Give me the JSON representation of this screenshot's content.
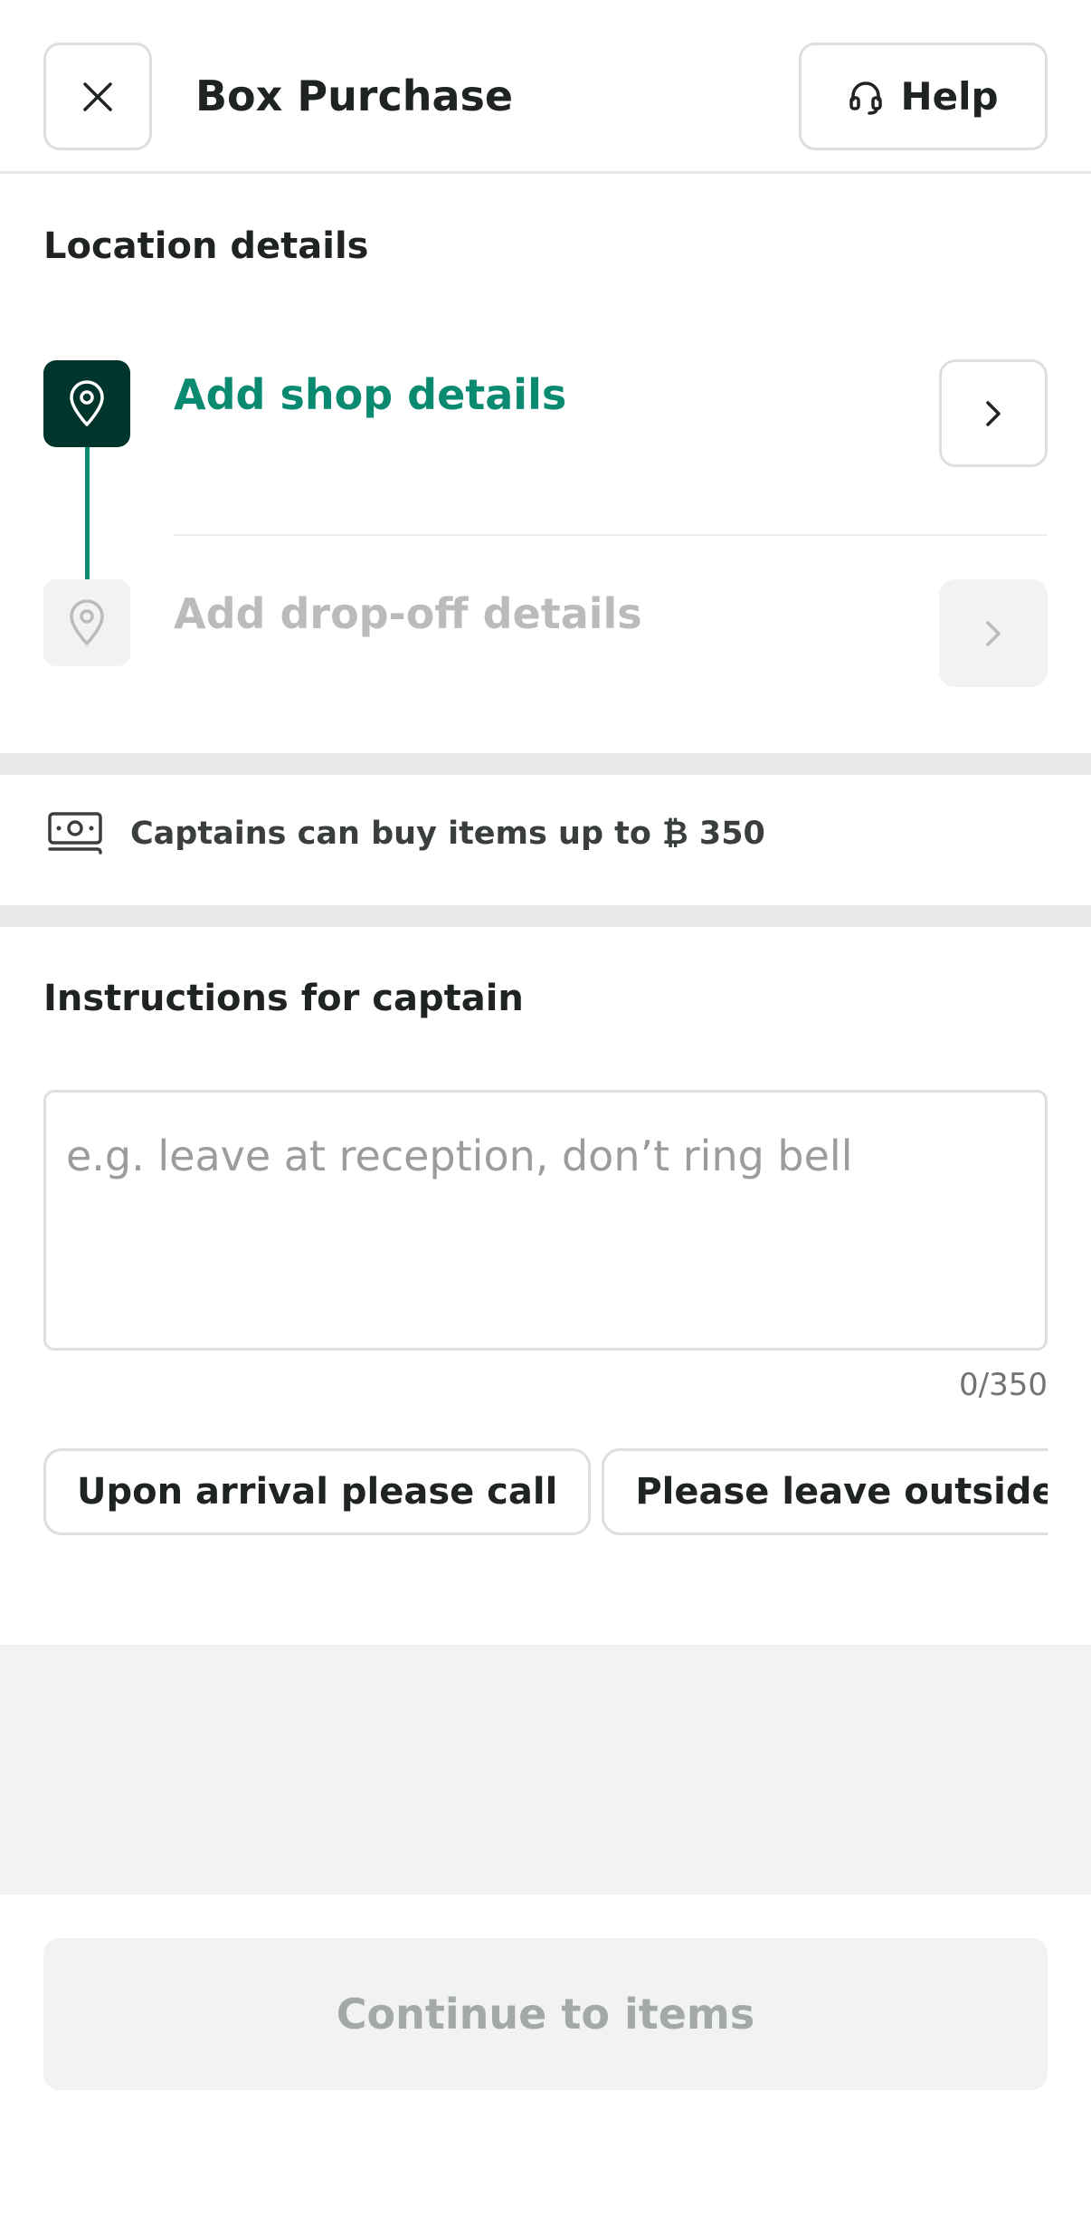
{
  "header": {
    "title": "Box Purchase",
    "help_label": "Help"
  },
  "location": {
    "section_title": "Location details",
    "pickup_label": "Add shop details",
    "dropoff_label": "Add drop-off details"
  },
  "limit": {
    "text": "Captains can buy items up to ₿ 350"
  },
  "instructions": {
    "section_title": "Instructions for captain",
    "placeholder": "e.g. leave at reception, don’t ring bell",
    "counter": "0/350",
    "chips": [
      "Upon arrival please call",
      "Please leave outside the door"
    ]
  },
  "footer": {
    "continue_label": "Continue to items"
  },
  "colors": {
    "accent": "#0b8a72",
    "pin_active_bg": "#00352d",
    "disabled_text": "#b9bcba"
  }
}
